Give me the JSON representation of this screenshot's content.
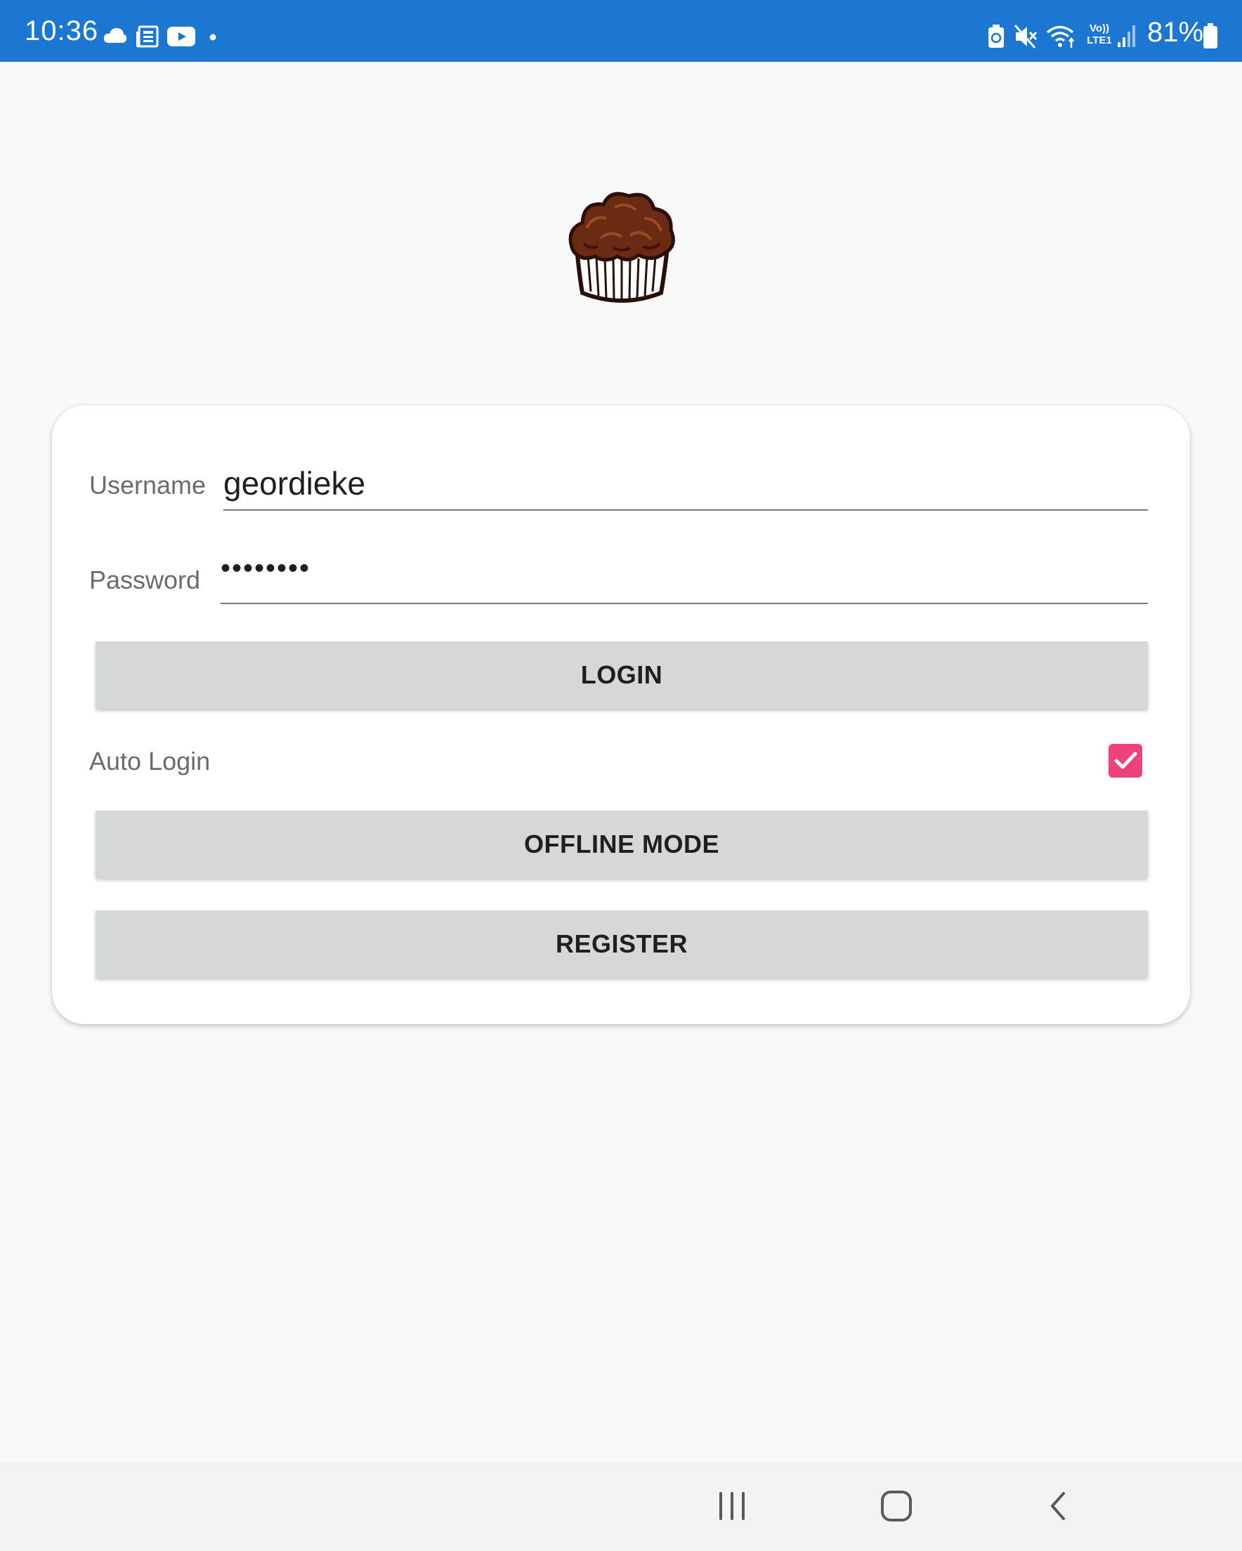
{
  "status_bar": {
    "time": "10:36",
    "left_icons": [
      "cloud-icon",
      "news-icon",
      "youtube-icon",
      "dot-icon"
    ],
    "right_icons": [
      "battery-saver-icon",
      "mute-icon",
      "wifi-icon",
      "volte-icon",
      "signal-icon"
    ],
    "volte_label": "Vo))",
    "lte_label": "LTE1",
    "battery_percent": "81%",
    "color": "#1c77d2"
  },
  "logo": {
    "icon": "muffin-logo-icon"
  },
  "login_form": {
    "username_label": "Username",
    "username_value": "geordieke",
    "password_label": "Password",
    "password_value": "••••••••",
    "login_button": "LOGIN",
    "auto_login_label": "Auto Login",
    "auto_login_checked": true,
    "offline_button": "OFFLINE MODE",
    "register_button": "REGISTER",
    "accent_color": "#f0427a"
  },
  "nav_bar": {
    "items": [
      "recent-apps-icon",
      "home-icon",
      "back-icon"
    ]
  }
}
